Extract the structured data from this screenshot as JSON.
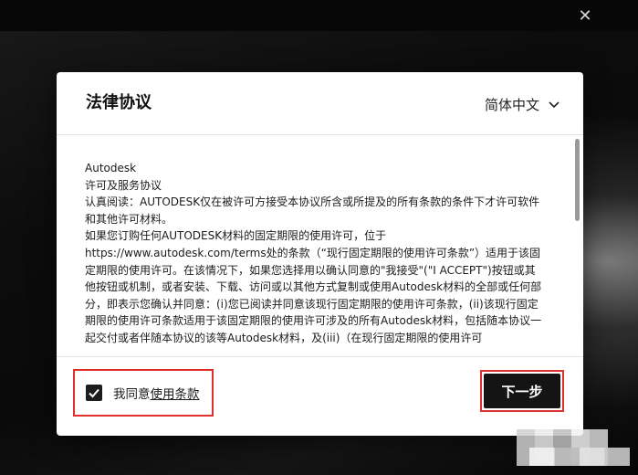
{
  "window": {
    "close_glyph": "✕"
  },
  "dialog": {
    "title": "法律协议",
    "language": "简体中文",
    "terms": [
      "Autodesk",
      "许可及服务协议",
      "认真阅读：AUTODESK仅在被许可方接受本协议所含或所提及的所有条款的条件下才许可软件和其他许可材料。",
      "如果您订购任何AUTODESK材料的固定期限的使用许可，位于https://www.autodesk.com/terms处的条款（“现行固定期限的使用许可条款”）适用于该固定期限的使用许可。在该情况下，如果您选择用以确认同意的\"我接受\"(\"I ACCEPT\")按钮或其他按钮或机制，或者安装、下载、访问或以其他方式复制或使用Autodesk材料的全部或任何部分，即表示您确认并同意：(i)您已阅读并同意该现行固定期限的使用许可条款，(ii)该现行固定期限的使用许可条款适用于该固定期限的使用许可涉及的所有Autodesk材料，包括随本协议一起交付或者伴随本协议的该等Autodesk材料，及(iii)（在现行固定期限的使用许可"
    ],
    "agree_prefix": "我同意",
    "agree_link": "使用条款",
    "agree_checked": true,
    "next_label": "下一步"
  },
  "colors": {
    "highlight": "#e0302b",
    "button_bg": "#141414"
  },
  "icons": {
    "checkbox": "check-icon",
    "language": "chevron-down-icon",
    "close": "close-icon"
  }
}
